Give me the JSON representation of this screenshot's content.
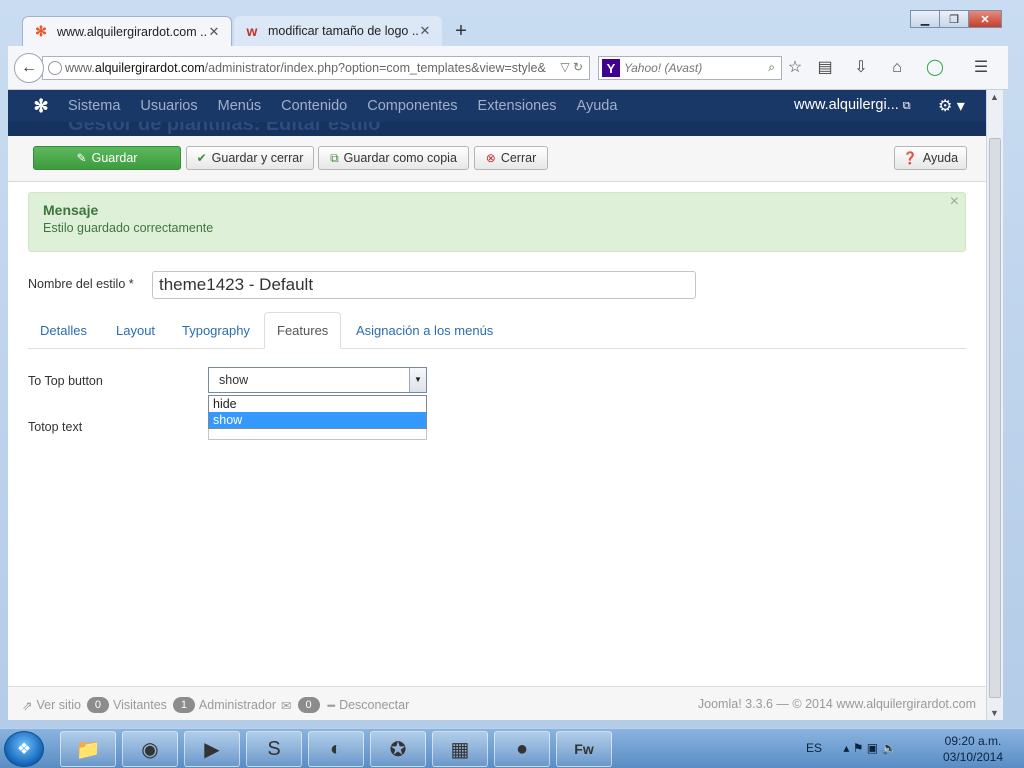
{
  "browser": {
    "tabs": [
      {
        "title": "www.alquilergirardot.com ...",
        "close": "✕"
      },
      {
        "title": "modificar tamaño de logo ...",
        "close": "✕"
      }
    ],
    "new_tab": "+",
    "url_prefix": "www.",
    "url_domain": "alquilergirardot.com",
    "url_path": "/administrator/index.php?option=com_templates&view=style&",
    "search_engine": "Y",
    "search_placeholder": "Yahoo! (Avast)"
  },
  "joomla": {
    "menu": [
      "Sistema",
      "Usuarios",
      "Menús",
      "Contenido",
      "Componentes",
      "Extensiones",
      "Ayuda"
    ],
    "site_link": "www.alquilergi...",
    "header_partial": "Gestor de plantillas: Editar estilo",
    "toolbar": {
      "save": "Guardar",
      "save_close": "Guardar y cerrar",
      "save_copy": "Guardar como copia",
      "close": "Cerrar",
      "help": "Ayuda"
    },
    "message": {
      "title": "Mensaje",
      "text": "Estilo guardado correctamente"
    },
    "style_name_label": "Nombre del estilo *",
    "style_name_value": "theme1423 - Default",
    "tabs": [
      "Detalles",
      "Layout",
      "Typography",
      "Features",
      "Asignación a los menús"
    ],
    "active_tab": "Features",
    "fields": {
      "totop_button_label": "To Top button",
      "totop_button_value": "show",
      "totop_button_options": [
        "hide",
        "show"
      ],
      "totop_text_label": "Totop text"
    },
    "footer": {
      "view_site": "Ver sitio",
      "visitors_count": "0",
      "visitors_label": "Visitantes",
      "admin_count": "1",
      "admin_label": "Administrador",
      "messages_count": "0",
      "logout": "Desconectar",
      "credits": "Joomla! 3.3.6 — © 2014 www.alquilergirardot.com"
    }
  },
  "taskbar": {
    "language": "ES",
    "time": "09:20 a.m.",
    "date": "03/10/2014"
  },
  "colors": {
    "joomla_nav": "#1a3867",
    "save_green": "#5cb85c",
    "alert_bg": "#dff0d8",
    "link_blue": "#2a6cb3",
    "selected_option": "#3399ff"
  }
}
